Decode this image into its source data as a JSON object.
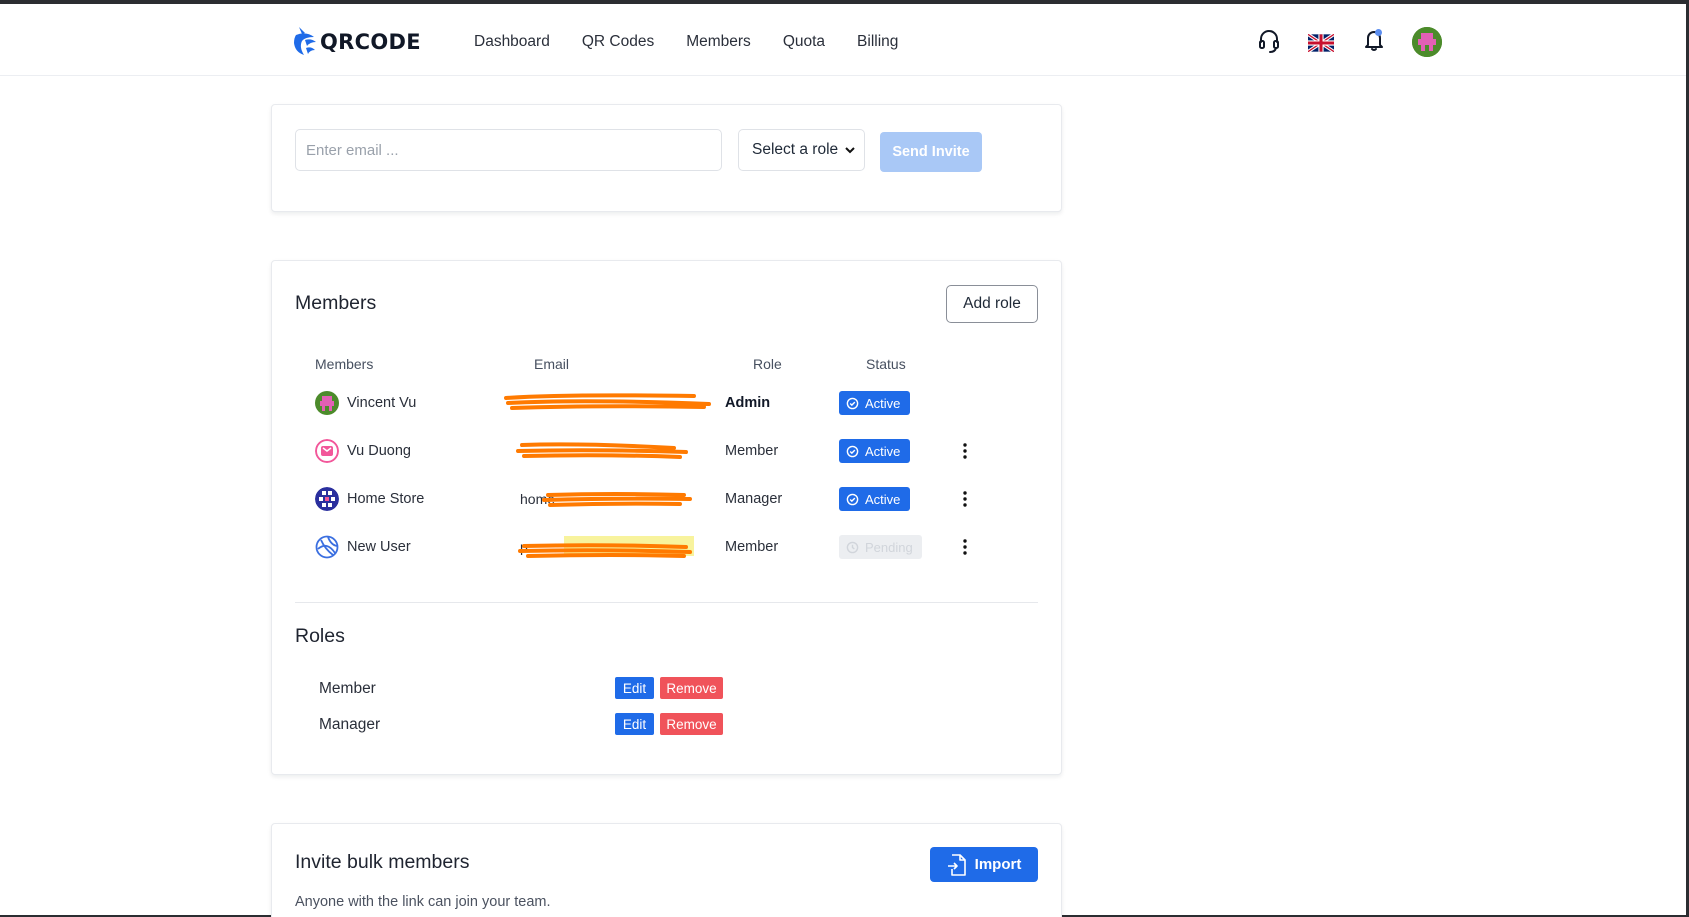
{
  "brand": {
    "name": "QRCODE"
  },
  "nav": [
    "Dashboard",
    "QR Codes",
    "Members",
    "Quota",
    "Billing"
  ],
  "header_icons": [
    "headset-icon",
    "uk-flag-icon",
    "bell-icon",
    "user-avatar"
  ],
  "invite": {
    "email_placeholder": "Enter email ...",
    "role_select": "Select a role",
    "send_label": "Send Invite"
  },
  "members": {
    "title": "Members",
    "add_role_label": "Add role",
    "columns": {
      "members": "Members",
      "email": "Email",
      "role": "Role",
      "status": "Status"
    },
    "rows": [
      {
        "name": "Vincent Vu",
        "email": "",
        "role": "Admin",
        "status": "Active",
        "has_menu": false
      },
      {
        "name": "Vu Duong",
        "email": "",
        "role": "Member",
        "status": "Active",
        "has_menu": true
      },
      {
        "name": "Home Store",
        "email": "home",
        "role": "Manager",
        "status": "Active",
        "has_menu": true
      },
      {
        "name": "New User",
        "email": "p",
        "role": "Member",
        "status": "Pending",
        "has_menu": true
      }
    ]
  },
  "roles": {
    "title": "Roles",
    "items": [
      {
        "name": "Member",
        "edit": "Edit",
        "remove": "Remove"
      },
      {
        "name": "Manager",
        "edit": "Edit",
        "remove": "Remove"
      }
    ]
  },
  "bulk": {
    "title": "Invite bulk members",
    "subtitle": "Anyone with the link can join your team.",
    "import_label": "Import"
  },
  "colors": {
    "primary": "#1f6be8",
    "danger": "#f0535a",
    "disabled_primary": "#a9c8f6",
    "redaction": "#ff7a00"
  }
}
